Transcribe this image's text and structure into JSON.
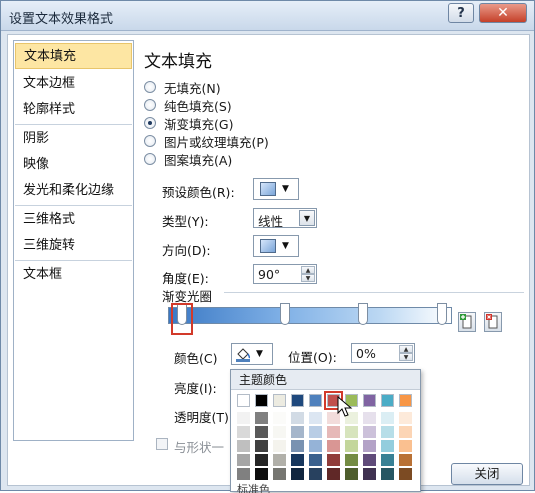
{
  "window": {
    "title": "设置文本效果格式",
    "help_label": "?",
    "close_label": "✕"
  },
  "sidebar": {
    "items": [
      {
        "label": "文本填充"
      },
      {
        "label": "文本边框"
      },
      {
        "label": "轮廓样式"
      },
      {
        "label": "阴影"
      },
      {
        "label": "映像"
      },
      {
        "label": "发光和柔化边缘"
      },
      {
        "label": "三维格式"
      },
      {
        "label": "三维旋转"
      },
      {
        "label": "文本框"
      }
    ]
  },
  "panel": {
    "heading": "文本填充",
    "fill_options": [
      {
        "label": "无填充(N)",
        "selected": false
      },
      {
        "label": "纯色填充(S)",
        "selected": false
      },
      {
        "label": "渐变填充(G)",
        "selected": true
      },
      {
        "label": "图片或纹理填充(P)",
        "selected": false
      },
      {
        "label": "图案填充(A)",
        "selected": false
      }
    ],
    "preset_label": "预设颜色(R):",
    "type_label": "类型(Y):",
    "type_value": "线性",
    "direction_label": "方向(D):",
    "angle_label": "角度(E):",
    "angle_value": "90°",
    "gradient_stops_label": "渐变光圈",
    "color_label": "颜色(C)",
    "position_label": "位置(O):",
    "position_value": "0%",
    "brightness_label": "亮度(I):",
    "transparency_label": "透明度(T)",
    "rotate_with_shape_label": "与形状一"
  },
  "color_popup": {
    "title": "主题颜色",
    "theme_colors": [
      "#ffffff",
      "#000000",
      "#ecebe1",
      "#1f497d",
      "#4f81bd",
      "#c0504d",
      "#9bbb59",
      "#8064a2",
      "#4bacc6",
      "#f79646"
    ],
    "selected_index": 5,
    "bottom_label": "标准色"
  },
  "footer": {
    "close_label": "关闭"
  }
}
